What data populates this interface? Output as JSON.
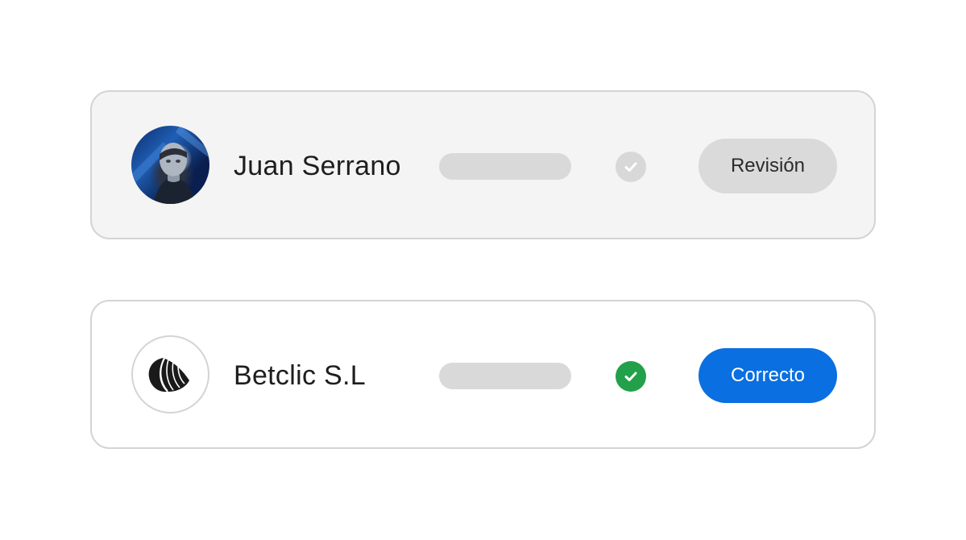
{
  "rows": [
    {
      "name": "Juan Serrano",
      "avatar_icon": "person-photo-icon",
      "status_icon": "check-icon",
      "status_color": "#d8d8d8",
      "action_label": "Revisión",
      "action_color": "#dadada"
    },
    {
      "name": "Betclic S.L",
      "avatar_icon": "betclic-logo-icon",
      "status_icon": "check-icon",
      "status_color": "#22a04a",
      "action_label": "Correcto",
      "action_color": "#0a6fe0"
    }
  ]
}
